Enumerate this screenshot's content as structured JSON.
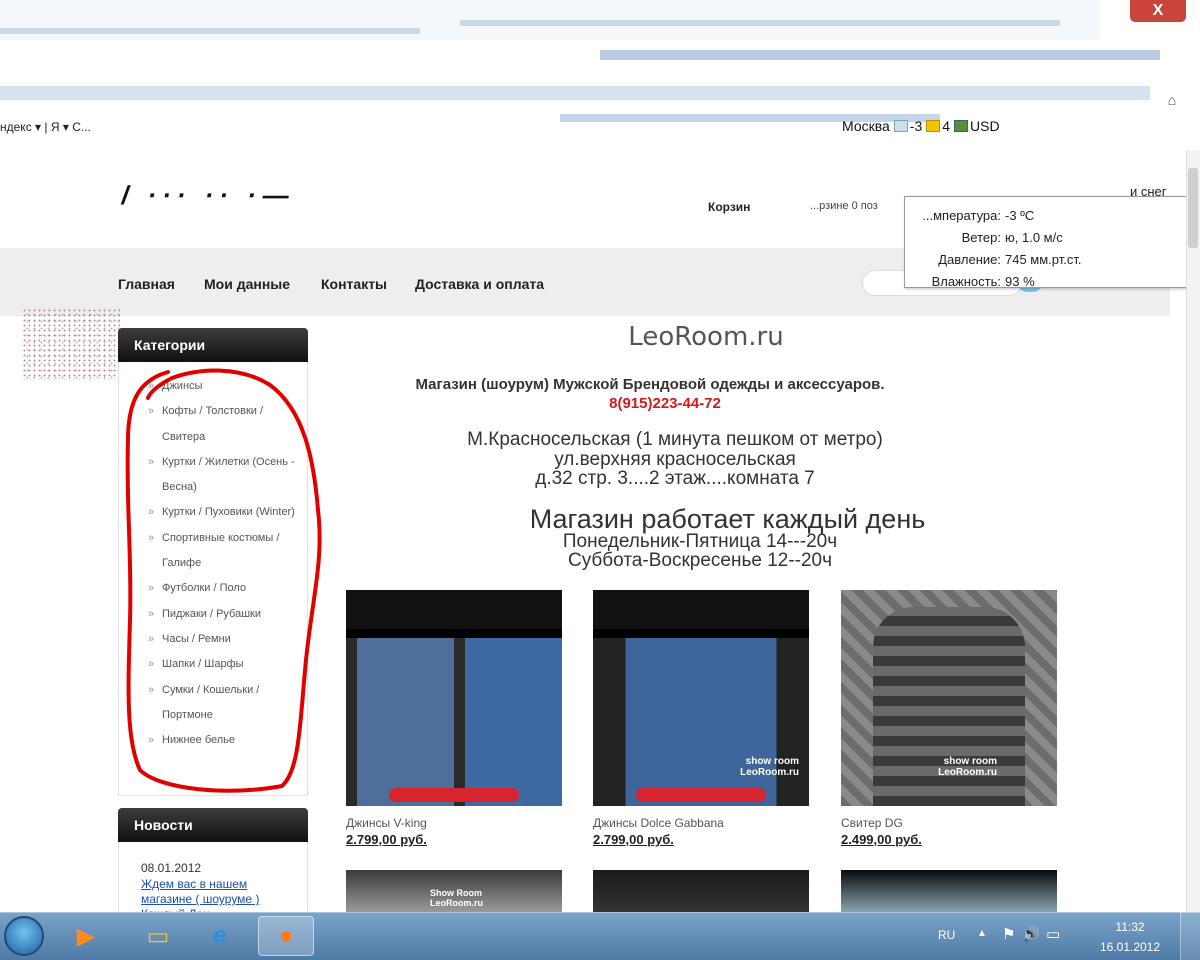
{
  "browser": {
    "close_label": "X",
    "toolbar_fragment": "ндекс ▾ | Я ▾ С...",
    "city": "Москва",
    "temp_short": "-3",
    "sun_value": "4",
    "currency": "USD"
  },
  "header": {
    "cart_label": "Корзин",
    "cart_info": "...рзине 0 поз",
    "snow_label": "и снег",
    "logo_fragment": "/ ···  ·· ·—"
  },
  "weather": {
    "rows": [
      {
        "label": "...мпература:",
        "value": "-3 ºC"
      },
      {
        "label": "Ветер:",
        "value": "ю, 1.0 м/с"
      },
      {
        "label": "Давление:",
        "value": "745 мм.рт.ст."
      },
      {
        "label": "Влажность:",
        "value": "93 %"
      }
    ]
  },
  "nav": {
    "items": [
      "Главная",
      "Мои данные",
      "Контакты",
      "Доставка и оплата"
    ]
  },
  "sidebar": {
    "categories_title": "Категории",
    "categories": [
      "Джинсы",
      "Кофты / Толстовки / Свитера",
      "Куртки / Жилетки (Осень - Весна)",
      "Куртки / Пуховики (Winter)",
      "Спортивные костюмы / Галифе",
      "Футболки / Поло",
      "Пиджаки / Рубашки",
      "Часы / Ремни",
      "Шапки / Шарфы",
      "Сумки / Кошельки / Портмоне",
      "Нижнее белье"
    ],
    "news_title": "Новости",
    "news_date": "08.01.2012",
    "news_link": "Ждем вас в нашем магазине ( шоуруме )",
    "news_more": "Каждый Ден..."
  },
  "main": {
    "site_title": "LeoRoom.ru",
    "tagline": "Магазин (шоурум) Мужской Брендовой одежды и аксессуаров.",
    "phone": "8(915)223-44-72",
    "address": [
      "М.Красносельская (1 минута пешком от метро)",
      "ул.верхняя красносельская",
      "д.32 стр. 3....2 этаж....комната 7"
    ],
    "hours_title": "Магазин работает каждый день",
    "hours": [
      "Понедельник-Пятница 14---20ч",
      "Суббота-Воскресенье 12--20ч"
    ],
    "products": [
      {
        "name": "Джинсы V-king",
        "price": "2.799,00 руб.",
        "watermark": ""
      },
      {
        "name": "Джинсы Dolce Gabbana",
        "price": "2.799,00 руб.",
        "watermark": "show room\nLeoRoom.ru"
      },
      {
        "name": "Свитер DG",
        "price": "2.499,00 руб.",
        "watermark": "show room\nLeoRoom.ru"
      }
    ],
    "second_row_watermark": "Show Room\nLeoRoom.ru"
  },
  "taskbar": {
    "lang": "RU",
    "time": "11:32",
    "date": "16.01.2012"
  },
  "colors": {
    "phone": "#d11a1a",
    "annotation": "#e00000",
    "nav_bg": "#eeeeee",
    "block_head": "#1c1c1c"
  }
}
